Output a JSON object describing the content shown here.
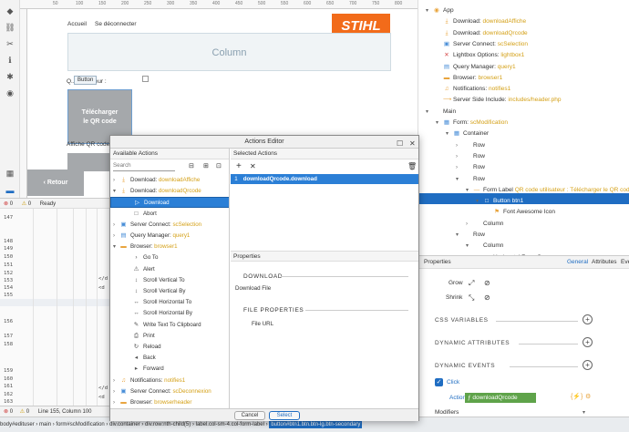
{
  "left_toolbar": {
    "icons": [
      "diamond-icon",
      "link-icon",
      "tools-icon",
      "info-icon",
      "accessibility-icon",
      "eye-icon"
    ],
    "bottom_icons": [
      "grid-icon",
      "panel-icon"
    ]
  },
  "ruler": {
    "marks": [
      "50",
      "100",
      "150",
      "200",
      "250",
      "300",
      "350",
      "400",
      "450",
      "500",
      "550",
      "600",
      "650",
      "700",
      "750",
      "800",
      "850"
    ]
  },
  "design": {
    "nav_home": "Accueil",
    "nav_logout": "Se déconnecter",
    "logo": "STIHL",
    "column_label": "Column",
    "button_tag": "Button",
    "label_util": "Q... utilisateur :",
    "qr_button_line1": "Télécharger",
    "qr_button_line2": "le QR code",
    "label_affiche": "Affiche QR code",
    "retour": "Retour"
  },
  "code_header": {
    "line_info": "0",
    "ready": "Ready",
    "warnings": "0"
  },
  "code": {
    "line_numbers": [
      "147",
      "148",
      "149",
      "150",
      "151",
      "152",
      "153",
      "154",
      "155",
      "156",
      "157",
      "158",
      "159",
      "160",
      "161",
      "162",
      "163"
    ],
    "snippet_1": "</d",
    "snippet_2": "<d",
    "snippet_3": "</d",
    "snippet_4": "<d"
  },
  "statusbar": {
    "errors": "0",
    "warnings": "0",
    "position": "Line 155, Column 100"
  },
  "breadcrumb": {
    "parts": [
      "body#edituser",
      "main",
      "form#scModification",
      "div.container",
      "div.row:nth-child(5)",
      "label.col-sm-4.col-form-label",
      "button#btn1.btn.btn-lg.btn-secondary"
    ],
    "selected": "button#btn1.btn.btn-lg.btn-secondary"
  },
  "tree": [
    {
      "indent": 0,
      "car": "▾",
      "icon": "◉",
      "label": "App",
      "sub": "",
      "color": "#e8a33a"
    },
    {
      "indent": 1,
      "car": "",
      "icon": "⤓",
      "label": "Download: ",
      "sub": "downloadAffiche",
      "color": "#e8a33a"
    },
    {
      "indent": 1,
      "car": "",
      "icon": "⤓",
      "label": "Download: ",
      "sub": "downloadQrcode",
      "color": "#e8a33a"
    },
    {
      "indent": 1,
      "car": "",
      "icon": "▣",
      "label": "Server Connect: ",
      "sub": "scSelection",
      "color": "#4a8fd8"
    },
    {
      "indent": 1,
      "car": "",
      "icon": "✕",
      "label": "Lightbox Options: ",
      "sub": "lightbox1",
      "color": "#d64a4a"
    },
    {
      "indent": 1,
      "car": "",
      "icon": "▤",
      "label": "Query Manager: ",
      "sub": "query1",
      "color": "#4a8fd8"
    },
    {
      "indent": 1,
      "car": "",
      "icon": "▬",
      "label": "Browser: ",
      "sub": "browser1",
      "color": "#e8a33a"
    },
    {
      "indent": 1,
      "car": "",
      "icon": "♫",
      "label": "Notifications: ",
      "sub": "notifies1",
      "color": "#e8a33a"
    },
    {
      "indent": 1,
      "car": "",
      "icon": "⟶",
      "label": "Server Side Include: ",
      "sub": "includes/header.php",
      "color": "#e8a33a"
    },
    {
      "indent": 0,
      "car": "▾",
      "icon": "",
      "label": "Main",
      "sub": "",
      "color": "#444"
    },
    {
      "indent": 1,
      "car": "▾",
      "icon": "▦",
      "label": "Form: ",
      "sub": "scModification",
      "color": "#4a8fd8"
    },
    {
      "indent": 2,
      "car": "▾",
      "icon": "▦",
      "label": "Container",
      "sub": "",
      "color": "#4a8fd8"
    },
    {
      "indent": 3,
      "car": "›",
      "icon": "",
      "label": "Row",
      "sub": "",
      "color": "#444"
    },
    {
      "indent": 3,
      "car": "›",
      "icon": "",
      "label": "Row",
      "sub": "",
      "color": "#444"
    },
    {
      "indent": 3,
      "car": "›",
      "icon": "",
      "label": "Row",
      "sub": "",
      "color": "#444"
    },
    {
      "indent": 3,
      "car": "▾",
      "icon": "",
      "label": "Row",
      "sub": "",
      "color": "#444"
    },
    {
      "indent": 4,
      "car": "▾",
      "icon": "—",
      "label": "Form Label ",
      "sub": "QR code utilisateur : Télécharger le QR code",
      "color": "#e8a33a"
    },
    {
      "indent": 5,
      "car": "▾",
      "icon": "□",
      "label": "Button ",
      "sub": "btn1",
      "color": "#fff"
    },
    {
      "indent": 6,
      "car": "",
      "icon": "⚑",
      "label": "Font Awesome Icon",
      "sub": "",
      "color": "#e8a33a"
    },
    {
      "indent": 4,
      "car": "›",
      "icon": "",
      "label": "Column",
      "sub": "",
      "color": "#444"
    },
    {
      "indent": 3,
      "car": "▾",
      "icon": "",
      "label": "Row",
      "sub": "",
      "color": "#444"
    },
    {
      "indent": 4,
      "car": "▾",
      "icon": "",
      "label": "Column",
      "sub": "",
      "color": "#444"
    },
    {
      "indent": 5,
      "car": "›",
      "icon": "—",
      "label": "Horizontal Form Group",
      "sub": "",
      "color": "#e8a33a"
    }
  ],
  "properties": {
    "title": "Properties",
    "tabs": [
      "General",
      "Attributes",
      "Events"
    ],
    "grow": "Grow",
    "shrink": "Shrink",
    "css_vars": "CSS VARIABLES",
    "dyn_attrs": "DYNAMIC ATTRIBUTES",
    "dyn_events": "DYNAMIC EVENTS",
    "click": "Click",
    "action_label": "Action",
    "action_value": "downloadQrcode",
    "modifiers": "Modifiers"
  },
  "modal": {
    "title": "Actions Editor",
    "available_header": "Available Actions",
    "selected_header": "Selected Actions",
    "search_placeholder": "Search",
    "selected_action_index": "1",
    "selected_action": "downloadQrcode.download",
    "props_header": "Properties",
    "section_download": "DOWNLOAD",
    "download_desc": "Download File",
    "section_file": "FILE PROPERTIES",
    "file_url_label": "File URL",
    "cancel": "Cancel",
    "select": "Select"
  },
  "actions": [
    {
      "indent": 0,
      "car": "›",
      "icon": "⤓",
      "label": "Download: ",
      "sub": "downloadAffiche",
      "sel": false,
      "color": "#e8a33a"
    },
    {
      "indent": 0,
      "car": "▾",
      "icon": "⤓",
      "label": "Download: ",
      "sub": "downloadQrcode",
      "sel": false,
      "color": "#e8a33a"
    },
    {
      "indent": 1,
      "car": "",
      "icon": "▷",
      "label": "Download",
      "sub": "",
      "sel": true,
      "color": "#fff"
    },
    {
      "indent": 1,
      "car": "",
      "icon": "□",
      "label": "Abort",
      "sub": "",
      "sel": false,
      "color": "#555"
    },
    {
      "indent": 0,
      "car": "›",
      "icon": "▣",
      "label": "Server Connect: ",
      "sub": "scSelection",
      "sel": false,
      "color": "#4a8fd8"
    },
    {
      "indent": 0,
      "car": "›",
      "icon": "▤",
      "label": "Query Manager: ",
      "sub": "query1",
      "sel": false,
      "color": "#4a8fd8"
    },
    {
      "indent": 0,
      "car": "▾",
      "icon": "▬",
      "label": "Browser: ",
      "sub": "browser1",
      "sel": false,
      "color": "#e8a33a"
    },
    {
      "indent": 1,
      "car": "",
      "icon": "›",
      "label": "Go To",
      "sub": "",
      "sel": false,
      "color": "#555"
    },
    {
      "indent": 1,
      "car": "",
      "icon": "⚠",
      "label": "Alert",
      "sub": "",
      "sel": false,
      "color": "#555"
    },
    {
      "indent": 1,
      "car": "",
      "icon": "↕",
      "label": "Scroll Vertical To",
      "sub": "",
      "sel": false,
      "color": "#555"
    },
    {
      "indent": 1,
      "car": "",
      "icon": "↕",
      "label": "Scroll Vertical By",
      "sub": "",
      "sel": false,
      "color": "#555"
    },
    {
      "indent": 1,
      "car": "",
      "icon": "↔",
      "label": "Scroll Horizontal To",
      "sub": "",
      "sel": false,
      "color": "#555"
    },
    {
      "indent": 1,
      "car": "",
      "icon": "↔",
      "label": "Scroll Horizontal By",
      "sub": "",
      "sel": false,
      "color": "#555"
    },
    {
      "indent": 1,
      "car": "",
      "icon": "✎",
      "label": "Write Text To Clipboard",
      "sub": "",
      "sel": false,
      "color": "#555"
    },
    {
      "indent": 1,
      "car": "",
      "icon": "⎙",
      "label": "Print",
      "sub": "",
      "sel": false,
      "color": "#555"
    },
    {
      "indent": 1,
      "car": "",
      "icon": "↻",
      "label": "Reload",
      "sub": "",
      "sel": false,
      "color": "#555"
    },
    {
      "indent": 1,
      "car": "",
      "icon": "◂",
      "label": "Back",
      "sub": "",
      "sel": false,
      "color": "#555"
    },
    {
      "indent": 1,
      "car": "",
      "icon": "▸",
      "label": "Forward",
      "sub": "",
      "sel": false,
      "color": "#555"
    },
    {
      "indent": 0,
      "car": "›",
      "icon": "♫",
      "label": "Notifications: ",
      "sub": "notifies1",
      "sel": false,
      "color": "#e8a33a"
    },
    {
      "indent": 0,
      "car": "›",
      "icon": "▣",
      "label": "Server Connect: ",
      "sub": "scDeconnexion",
      "sel": false,
      "color": "#4a8fd8"
    },
    {
      "indent": 0,
      "car": "›",
      "icon": "▬",
      "label": "Browser: ",
      "sub": "browserheader",
      "sel": false,
      "color": "#e8a33a"
    }
  ]
}
